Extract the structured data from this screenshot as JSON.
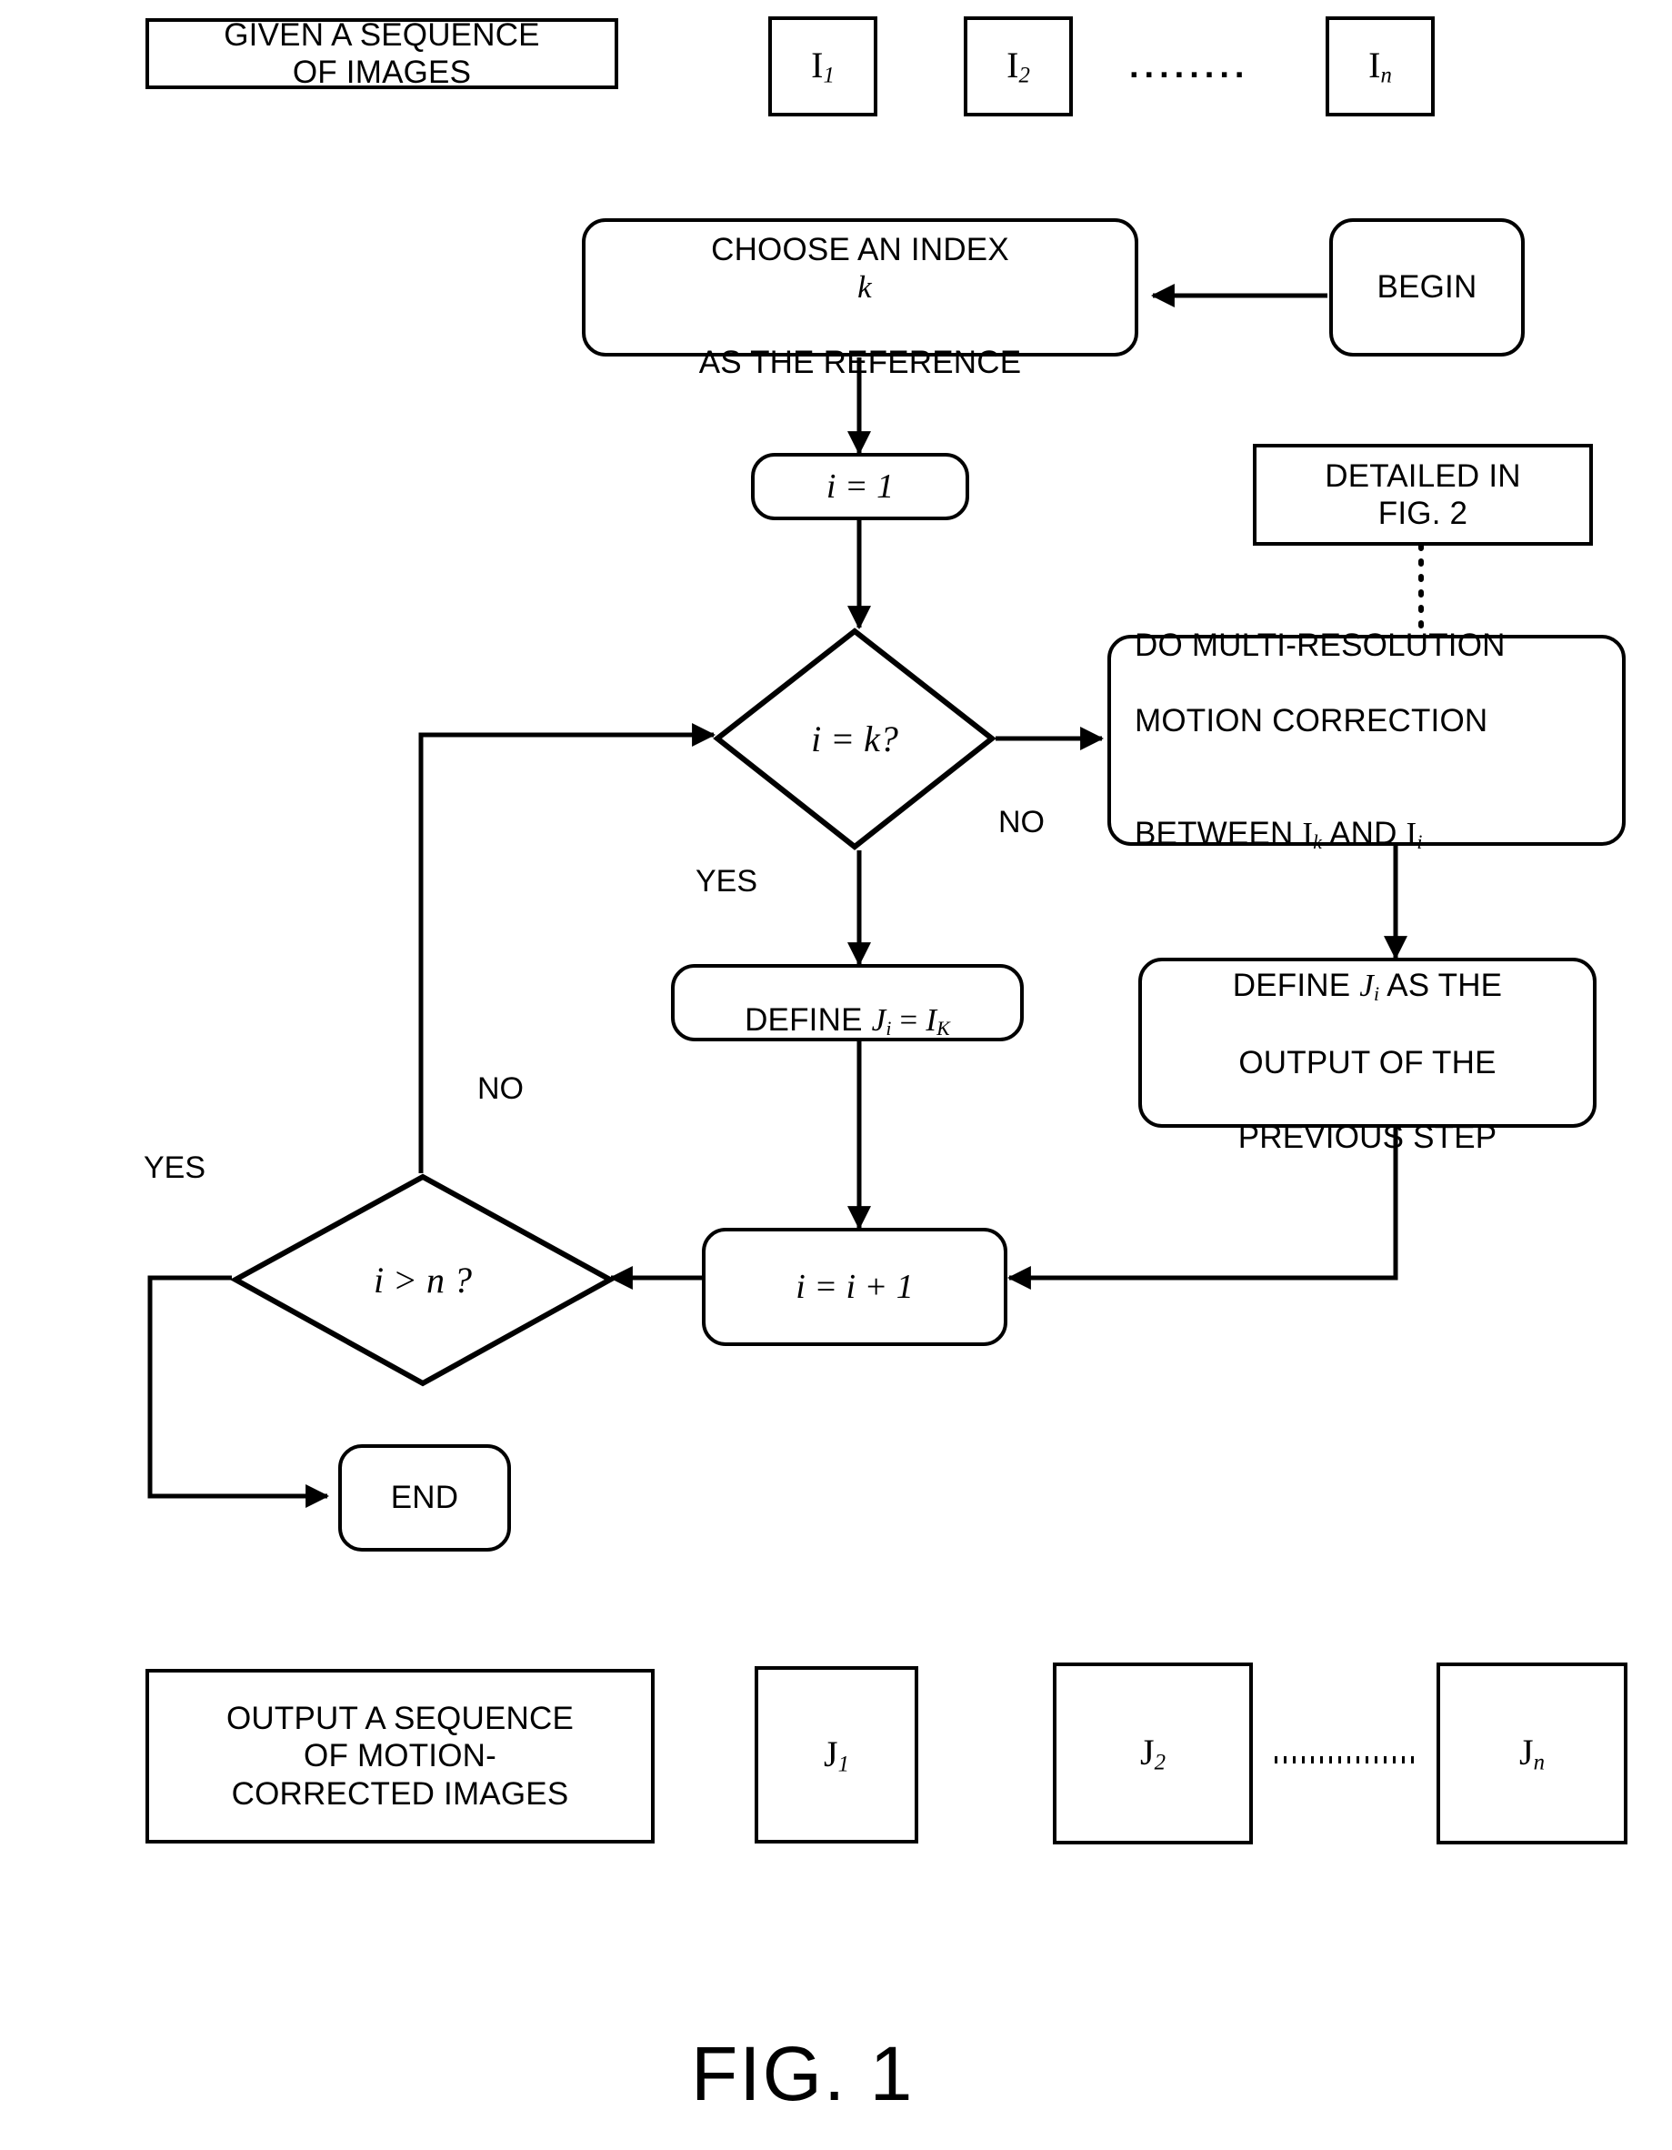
{
  "figure": {
    "caption": "FIG. 1"
  },
  "top_row": {
    "given_box": "GIVEN A   SEQUENCE\nOF IMAGES",
    "images": [
      {
        "base": "I",
        "sub": "1"
      },
      {
        "base": "I",
        "sub": "2"
      },
      {
        "base": "I",
        "sub": "n"
      }
    ],
    "ellipsis": "........"
  },
  "nodes": {
    "begin": "BEGIN",
    "choose_index": "CHOOSE AN INDEX  k\nAS THE REFERENCE",
    "choose_index_plain": "CHOOSE AN INDEX",
    "choose_index_var": "k",
    "choose_index_line2": "AS THE REFERENCE",
    "init_i": "i = 1",
    "detailed_in_fig2": "DETAILED IN\nFIG. 2",
    "decision_i_eq_k": "i = k?",
    "motion_correction_line1": "DO MULTI-RESOLUTION",
    "motion_correction_line2": "MOTION CORRECTION",
    "motion_correction_line3_a": "BETWEEN ",
    "motion_correction_line3_ik": "I",
    "motion_correction_line3_ik_sub": "k",
    "motion_correction_line3_b": " AND ",
    "motion_correction_line3_ii": "I",
    "motion_correction_line3_ii_sub": "i",
    "define_ji_eq_ik": "DEFINE J_i = I_K",
    "define_ji_prefix": "DEFINE ",
    "define_ji_j": "J",
    "define_ji_j_sub": "i",
    "define_ji_eq": " = ",
    "define_ji_i": "I",
    "define_ji_i_sub": "K",
    "define_output_line1_a": "DEFINE ",
    "define_output_line1_j": "J",
    "define_output_line1_j_sub": "i",
    "define_output_line1_b": "  AS THE",
    "define_output_line2": "OUTPUT OF THE",
    "define_output_line3": "PREVIOUS STEP",
    "decision_i_gt_n": "i > n ?",
    "increment_i": "i = i + 1",
    "end": "END"
  },
  "edge_labels": {
    "yes_from_i_eq_k": "YES",
    "no_from_i_eq_k": "NO",
    "no_from_i_gt_n": "NO",
    "yes_from_i_gt_n": "YES"
  },
  "bottom_row": {
    "output_box": "OUTPUT A SEQUENCE\nOF MOTION-\nCORRECTED  IMAGES",
    "images": [
      {
        "base": "J",
        "sub": "1"
      },
      {
        "base": "J",
        "sub": "2"
      },
      {
        "base": "J",
        "sub": "n"
      }
    ]
  },
  "colors": {
    "stroke": "#000000",
    "background": "#ffffff"
  }
}
